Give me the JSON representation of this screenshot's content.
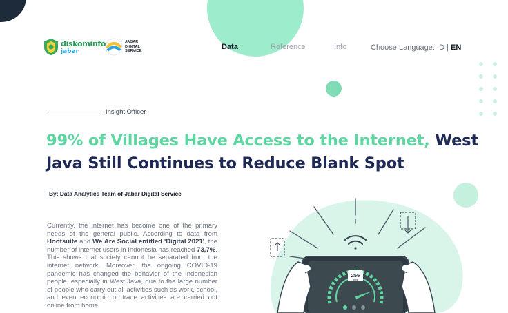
{
  "header": {
    "logo_diskominfo": {
      "name": "diskominfo",
      "sub": "jabar"
    },
    "logo_jds": {
      "line1": "JABAR",
      "line2": "DIGITAL",
      "line3": "SERVICE"
    },
    "nav": [
      {
        "label": "Data",
        "active": true
      },
      {
        "label": "Reference",
        "active": false
      },
      {
        "label": "Info",
        "active": false
      }
    ],
    "language": {
      "prefix": "Choose Language: ",
      "id": "ID",
      "separator": " | ",
      "en": "EN"
    }
  },
  "article": {
    "category": "Insight Officer",
    "title_highlight": "99% of Villages Have Access to the Internet,",
    "title_rest": "West Java Still Continues to Reduce Blank Spot",
    "byline": "By: Data Analytics Team of Jabar Digital Service",
    "body": {
      "p1": "Currently, the internet has become one of the primary needs of the general public. According to data from ",
      "hootsuite": "Hootsuite",
      "and": " and ",
      "we_are_social": "We Are Social entitled 'Digital 2021'",
      "p2": ", the number of internet users in Indonesia has reached ",
      "percent": "73,7%",
      "p3": ". This shows that society cannot be separated from the internet network. Moreover, the ongoing COVID-19 pandemic has changed the behavior of the Indonesian people, especially in West Java, due to the large number of people who carry out all activities such as work, school, and even economic or trade activities are carried out online from home."
    }
  },
  "illustration": {
    "speed_value": "256",
    "speed_unit": "kbps"
  },
  "colors": {
    "accent_green": "#5fd6a2",
    "navy": "#1e2a55",
    "mint_light": "#d9f5ea",
    "mint_circle": "#9deccb"
  }
}
